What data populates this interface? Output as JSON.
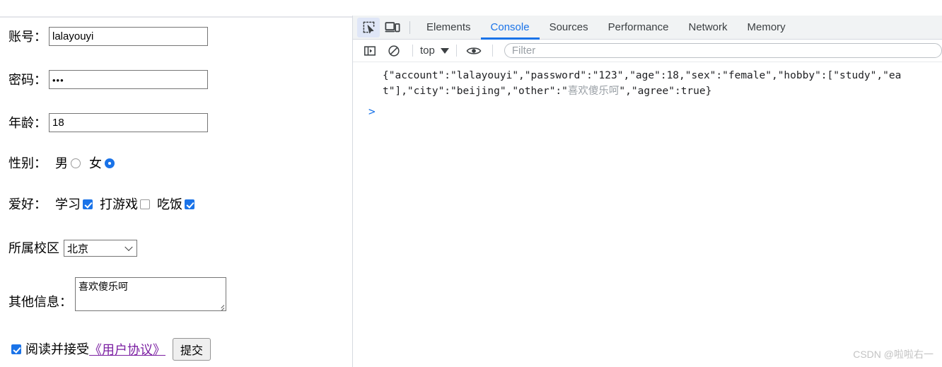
{
  "page": {
    "fields": {
      "account_label": "账号：",
      "account_value": "lalayouyi",
      "password_label": "密码：",
      "password_value": "•••",
      "age_label": "年龄：",
      "age_value": "18",
      "sex_label": "性别：",
      "sex_male": "男",
      "sex_female": "女",
      "hobby_label": "爱好：",
      "hobby_study": "学习",
      "hobby_game": "打游戏",
      "hobby_eat": "吃饭",
      "campus_label": "所属校区",
      "campus_value": "北京",
      "other_label": "其他信息：",
      "other_value": "喜欢傻乐呵",
      "agree_text": "阅读并接受",
      "agree_link": "《用户协议》",
      "submit_label": "提交"
    }
  },
  "devtools": {
    "icons": {
      "inspect": "inspect-element-icon",
      "device": "device-toolbar-icon",
      "sidebar": "console-sidebar-icon",
      "clear": "clear-console-icon",
      "eye": "live-expression-eye-icon"
    },
    "tabs": [
      {
        "label": "Elements",
        "selected": false
      },
      {
        "label": "Console",
        "selected": true
      },
      {
        "label": "Sources",
        "selected": false
      },
      {
        "label": "Performance",
        "selected": false
      },
      {
        "label": "Network",
        "selected": false
      },
      {
        "label": "Memory",
        "selected": false
      }
    ],
    "console_toolbar": {
      "context": "top",
      "filter_placeholder": "Filter",
      "filter_value": ""
    },
    "console_output": {
      "line1_a": "{\"account\":\"lalayouyi\",\"password\":\"123\",\"age\":18,\"sex\":\"female\",\"hobby\":",
      "line2_a": "[\"study\",\"eat\"],\"city\":\"beijing\",\"other\":\"",
      "line2_cn": "喜欢傻乐呵",
      "line2_b": "\",\"agree\":true}",
      "prompt": ">"
    }
  },
  "watermark": "CSDN @啦啦右一",
  "colors": {
    "accent": "#1a73e8",
    "tabbar_bg": "#f1f3f4",
    "link_visited": "#7b1fa2",
    "watermark": "#c3c3c3"
  }
}
